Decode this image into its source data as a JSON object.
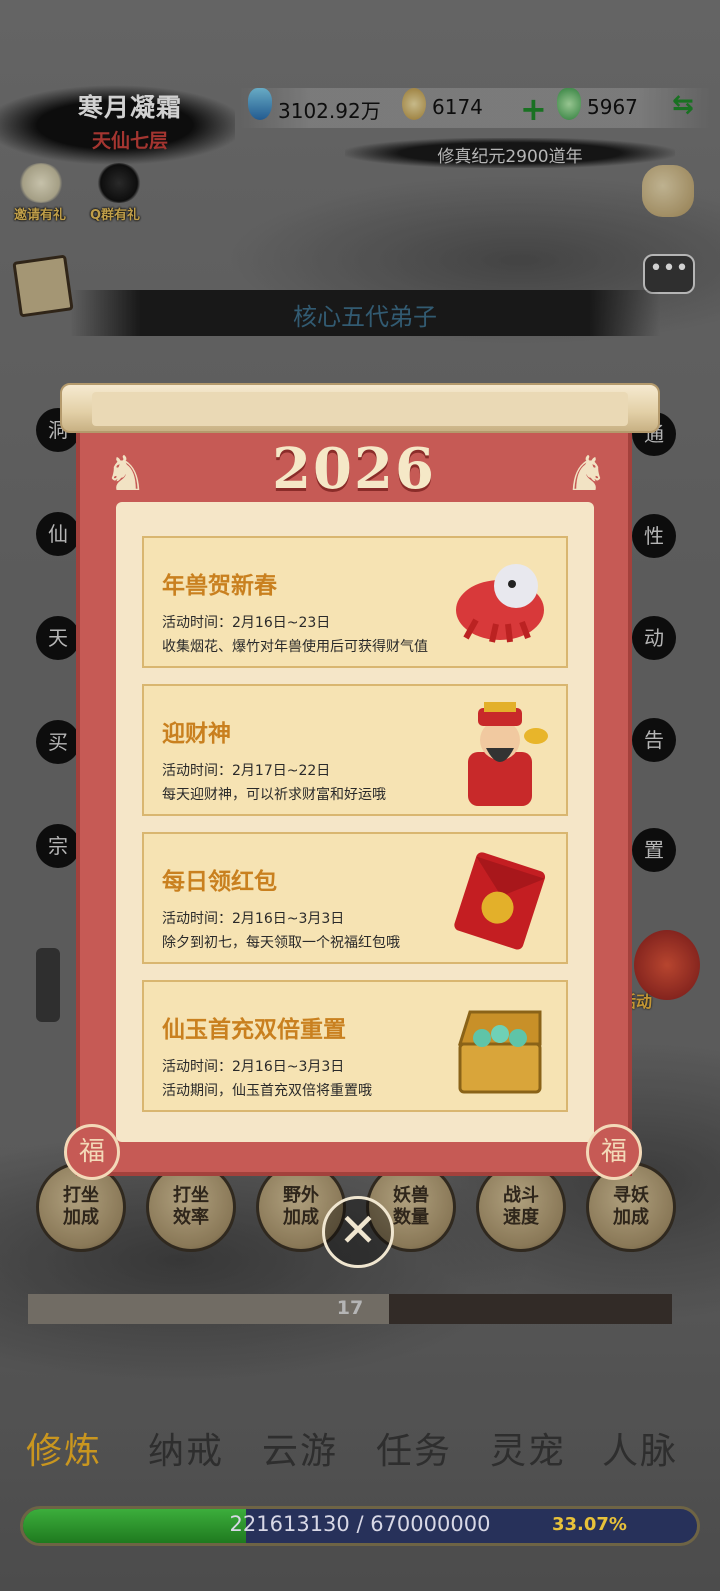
{
  "player": {
    "name": "寒月凝霜",
    "realm": "天仙七层"
  },
  "resources": {
    "spirit_stones": "3102.92万",
    "gold": "6174",
    "jade": "5967"
  },
  "era": "修真纪元2900道年",
  "top_icons": {
    "invite": "邀请有礼",
    "qq_group": "Q群有礼"
  },
  "disciple_title": "核心五代弟子",
  "side_left": [
    "洞",
    "仙",
    "天",
    "买",
    "宗"
  ],
  "side_right": [
    "通",
    "性",
    "动",
    "告",
    "置"
  ],
  "right_event_label": "活动",
  "popup": {
    "year": "2026",
    "fu_char": "福",
    "events": [
      {
        "title": "年兽贺新春",
        "time": "活动时间：2月16日~23日",
        "desc": "收集烟花、爆竹对年兽使用后可获得财气值",
        "icon": "nian-beast-icon"
      },
      {
        "title": "迎财神",
        "time": "活动时间：2月17日~22日",
        "desc": "每天迎财神，可以祈求财富和好运哦",
        "icon": "wealth-god-icon"
      },
      {
        "title": "每日领红包",
        "time": "活动时间：2月16日~3月3日",
        "desc": "除夕到初七，每天领取一个祝福红包哦",
        "icon": "red-envelope-icon"
      },
      {
        "title": "仙玉首充双倍重置",
        "time": "活动时间：2月16日~3月3日",
        "desc": "活动期间，仙玉首充双倍将重置哦",
        "icon": "treasure-chest-icon"
      }
    ]
  },
  "round_buttons": [
    {
      "l1": "打坐",
      "l2": "加成"
    },
    {
      "l1": "打坐",
      "l2": "效率"
    },
    {
      "l1": "野外",
      "l2": "加成"
    },
    {
      "l1": "妖兽",
      "l2": "数量"
    },
    {
      "l1": "战斗",
      "l2": "速度"
    },
    {
      "l1": "寻妖",
      "l2": "加成"
    }
  ],
  "level_progress": {
    "value": "17",
    "fraction": 0.56
  },
  "tabs": [
    "修炼",
    "纳戒",
    "云游",
    "任务",
    "灵宠",
    "人脉"
  ],
  "active_tab": 0,
  "exp": {
    "text": "221613130 / 670000000",
    "percent": "33.07%",
    "fraction": 0.3307
  },
  "colors": {
    "accent_gold": "#c9961f",
    "panel_red": "#c65a55",
    "card_title": "#c9801f"
  }
}
